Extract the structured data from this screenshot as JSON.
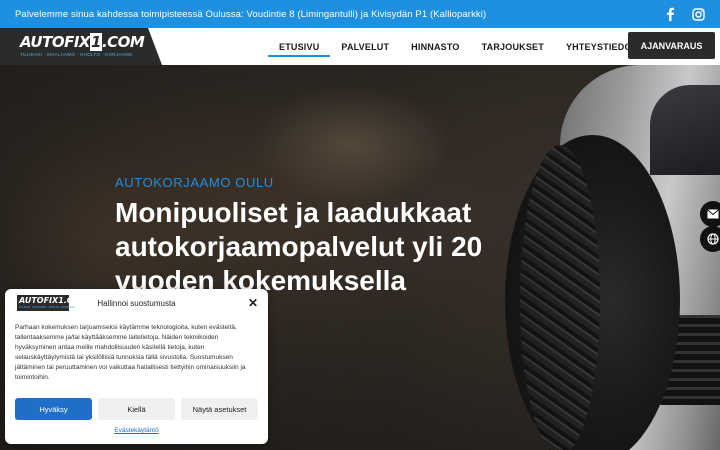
{
  "topbar": {
    "text": "Palvelemme sinua kahdessa toimipisteessä Oulussa: Voudintie 8 (Limingantulli) ja Kivisydän P1 (Kallioparkki)",
    "social": [
      "facebook-icon",
      "instagram-icon"
    ]
  },
  "header": {
    "logo": {
      "main_a": "AUTOFIX",
      "main_b": "1",
      "main_c": ".COM",
      "tagline": "TULIKASI · MAALAAMO · HUOLTO · KORJAAMO"
    },
    "nav": [
      "ETUSIVU",
      "PALVELUT",
      "HINNASTO",
      "TARJOUKSET",
      "YHTEYSTIEDOT"
    ],
    "active_nav": "ETUSIVU",
    "cta": "AJANVARAUS"
  },
  "hero": {
    "eyebrow": "AUTOKORJAAMO OULU",
    "headline": "Monipuoliset ja laadukkaat autokorjaamopalvelut yli 20 vuoden kokemuksella"
  },
  "side_buttons": [
    "mail-icon",
    "globe-icon"
  ],
  "cookie": {
    "logo_text": "AUTOFIX1.COM",
    "logo_tagline": "TULIKASI · MAALAAMO · HUOLTO · KORJAAMO",
    "title": "Hallinnoi suostumusta",
    "body": "Parhaan kokemuksen tarjoamiseksi käytämme teknologioita, kuten evästeitä, tallentaaksemme ja/tai käyttääksemme laitetietoja. Näiden tekniikoiden hyväksyminen antaa meille mahdollisuuden käsitellä tietoja, kuten selauskäyttäytymistä tai yksilöllisiä tunnuksia tällä sivustolla. Suostumuksen jättäminen tai peruuttaminen voi vaikuttaa haitallisesti tiettyihin ominaisuuksiin ja toimintoihin.",
    "accept": "Hyväksy",
    "deny": "Kiellä",
    "preferences": "Näytä asetukset",
    "policy_link": "Evästekäytäntö"
  },
  "colors": {
    "accent": "#1f8fe0",
    "dark": "#2b2b2b",
    "button_blue": "#1f6fc9"
  }
}
